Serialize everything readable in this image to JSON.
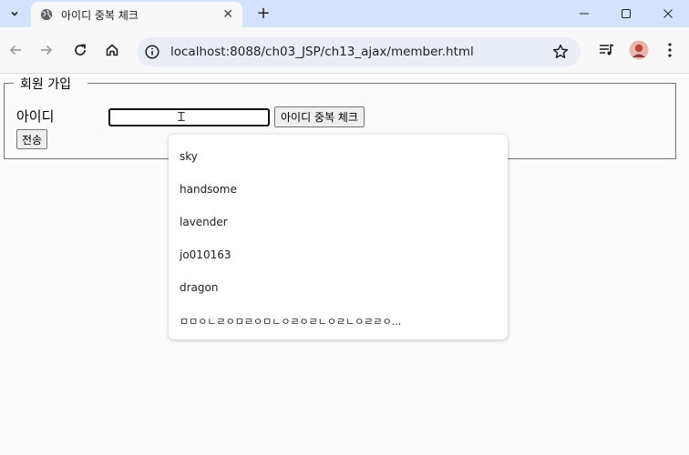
{
  "browser": {
    "tab": {
      "title": "아이디 중복 체크",
      "close_glyph": "✕"
    },
    "new_tab_glyph": "+",
    "address_bar": {
      "url": "localhost:8088/ch03_JSP/ch13_ajax/member.html"
    }
  },
  "form": {
    "legend": "회원 가입",
    "id_label": "아이디",
    "id_input_value": "",
    "check_button_label": "아이디 중복 체크",
    "submit_button_label": "전송"
  },
  "autocomplete": {
    "suggestions": [
      "sky",
      "handsome",
      "lavender",
      "jo010163",
      "dragon",
      "ㅁㅁㅇㄴㄹㅇㅁㄹㅇㅁㄴㅇㄹㅇㄹㄴㅇㄹㄴㅇㄹㄹㅇ..."
    ]
  }
}
